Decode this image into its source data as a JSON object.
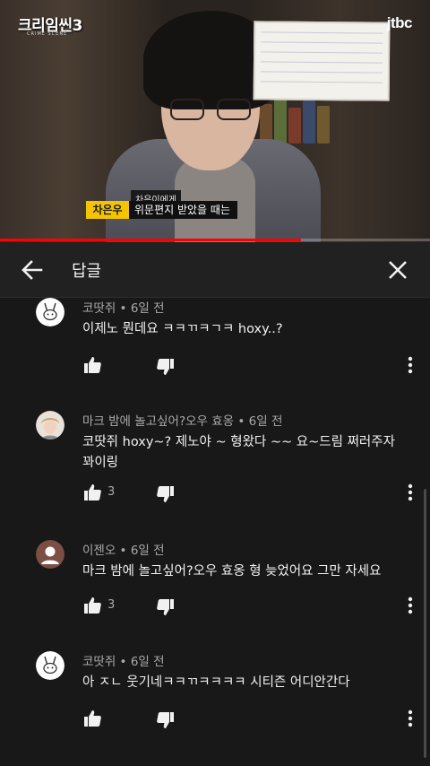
{
  "video": {
    "show_logo": "크리임씬3",
    "show_sub": "CRIME SCENE",
    "channel_logo": "jtbc",
    "caption_small": "차은이에게",
    "caption_name": "차은우",
    "caption_main": "위문편지 받았을 때는",
    "progress": 0.7,
    "progress_color": "#ff0000"
  },
  "header": {
    "title": "답글",
    "back_icon": "back-arrow-icon",
    "close_icon": "close-icon"
  },
  "comments": [
    {
      "author": "코땃쥐",
      "time": "6일 전",
      "text": "이제노 뭔데요 ㅋㅋㄲㅋㄱㅋ hoxy..?",
      "likes": "",
      "avatar": "rabbit-icon"
    },
    {
      "author": "마크 밤에 놀고싶어?오우 효옹",
      "time": "6일 전",
      "text": "코땃쥐 hoxy~? 제노야 ~ 형왔다 ~~ 요~드림 쩌러주자 꽈이링",
      "likes": "3",
      "avatar": "user-photo"
    },
    {
      "author": "이젠오",
      "time": "6일 전",
      "text": "마크 밤에 놀고싶어?오우 효옹  형 늦었어요 그만 자세요",
      "likes": "3",
      "avatar": "default-avatar-icon"
    },
    {
      "author": "코땃쥐",
      "time": "6일 전",
      "text": "아 ㅈㄴ 웃기네ㅋㅋㄲㅋㅋㅋㅋ 시티즌 어디안간다",
      "likes": "",
      "avatar": "rabbit-icon"
    }
  ],
  "meta_separator": " • "
}
